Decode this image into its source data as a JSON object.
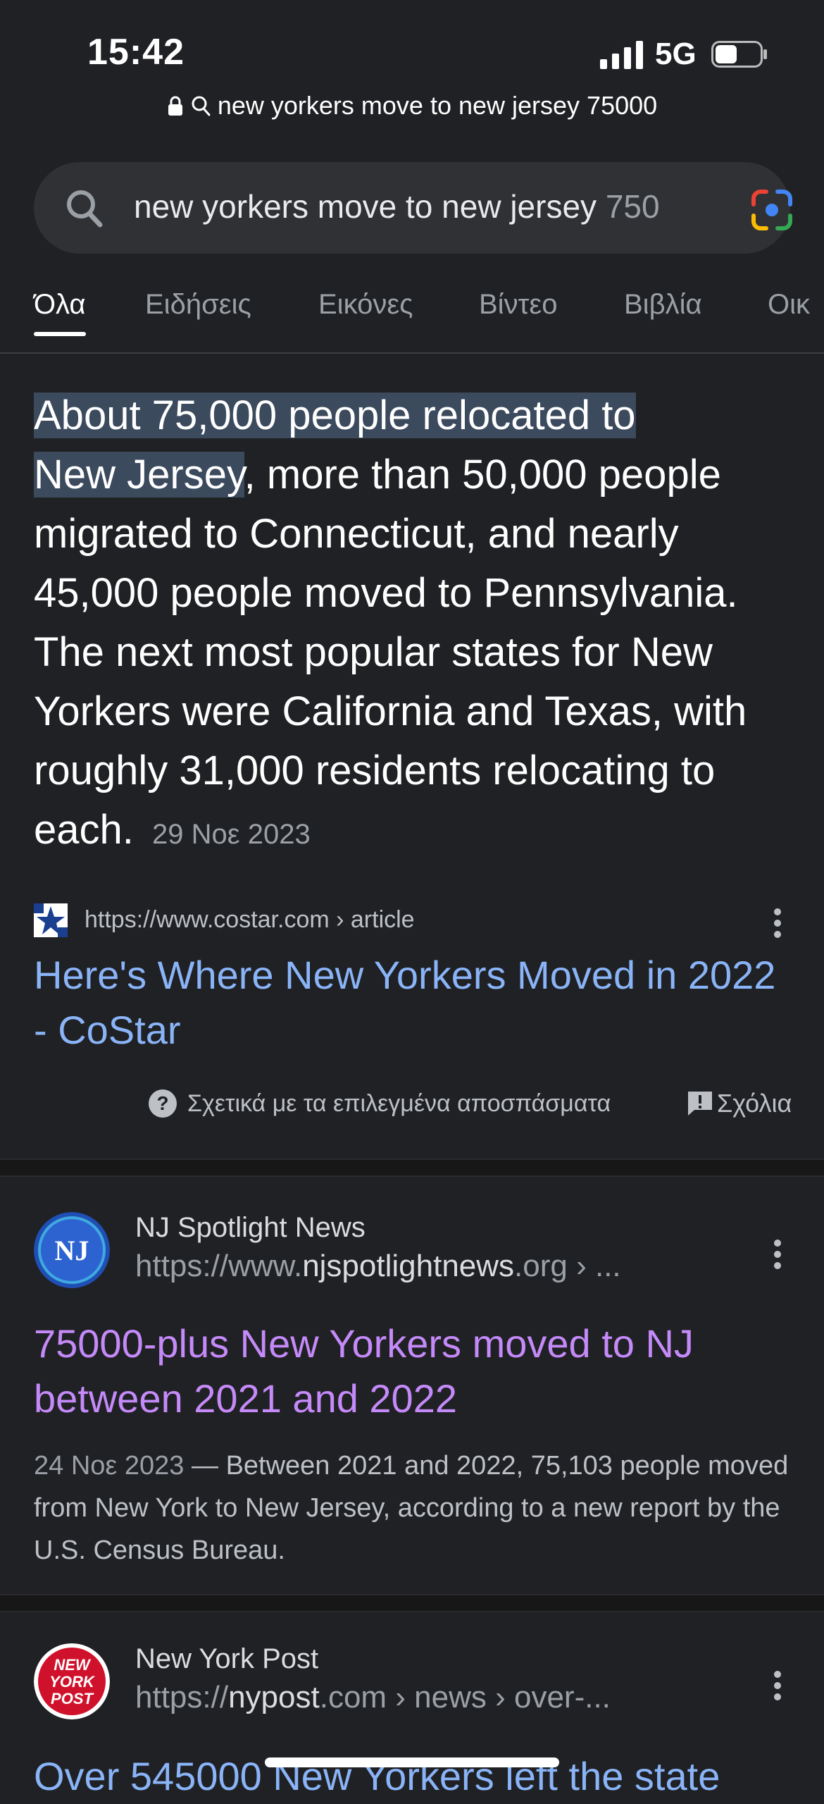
{
  "status_bar": {
    "time": "15:42",
    "network": "5G"
  },
  "url_bar": {
    "text": "new yorkers move to new jersey 75000"
  },
  "search": {
    "query_main": "new yorkers move to new jersey ",
    "query_tail": "750"
  },
  "tabs": [
    {
      "label": "Όλα",
      "active": true
    },
    {
      "label": "Ειδήσεις"
    },
    {
      "label": "Εικόνες"
    },
    {
      "label": "Βίντεο"
    },
    {
      "label": "Βιβλία"
    },
    {
      "label": "Οικ"
    }
  ],
  "featured_snippet": {
    "highlight_1": "About 75,000 people relocated to",
    "highlight_2": "New Jersey",
    "rest": ", more than 50,000 people migrated to Connecticut, and nearly 45,000 people moved to Pennsylvania. The next most popular states for New Yorkers were California and Texas, with roughly 31,000 residents relocating to each.",
    "date": "29 Νοε 2023",
    "source_url": "https://www.costar.com › article",
    "title": "Here's Where New Yorkers Moved in 2022 - CoStar",
    "about_label": "Σχετικά με τα επιλεγμένα αποσπάσματα",
    "feedback_label": "Σχόλια"
  },
  "results": [
    {
      "site": "NJ Spotlight News",
      "url_prefix": "https://www.",
      "url_domain": "njspotlightnews",
      "url_suffix": ".org › ...",
      "title": "75000-plus New Yorkers moved to NJ between 2021 and 2022",
      "date": "24 Νοε 2023",
      "snippet": "Between 2021 and 2022, 75,103 people moved from New York to New Jersey, according to a new report by the U.S. Census Bureau."
    },
    {
      "site": "New York Post",
      "url_prefix": "https://",
      "url_domain": "nypost",
      "url_suffix": ".com › news › over-...",
      "logo_text": [
        "NEW",
        "YORK",
        "POST"
      ],
      "title": "Over 545000 New Yorkers left the state"
    }
  ]
}
